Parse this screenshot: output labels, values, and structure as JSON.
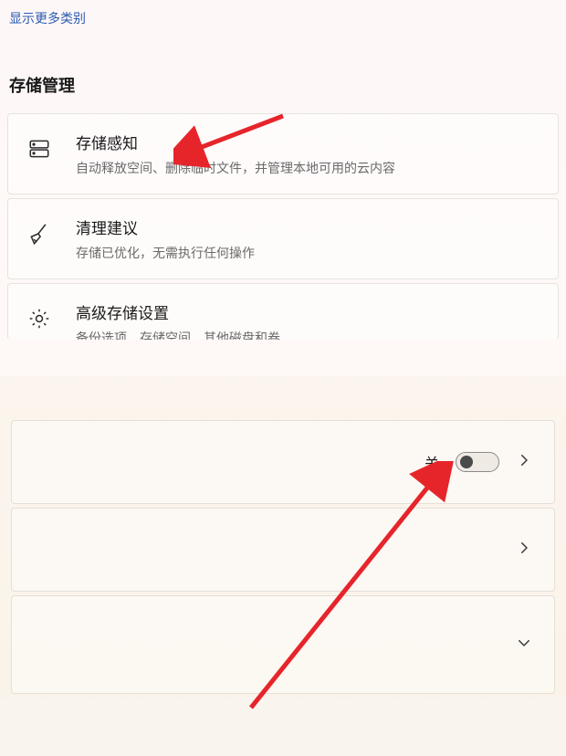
{
  "header": {
    "show_more_link": "显示更多类别",
    "section_heading": "存储管理"
  },
  "rows": {
    "storage_sense": {
      "title": "存储感知",
      "subtitle": "自动释放空间、删除临时文件，并管理本地可用的云内容"
    },
    "cleanup": {
      "title": "清理建议",
      "subtitle": "存储已优化，无需执行任何操作"
    },
    "advanced": {
      "title": "高级存储设置",
      "subtitle": "备份选项、存储空间、其他磁盘和卷"
    }
  },
  "panels": {
    "toggle_label": "关",
    "toggle_state": "off"
  }
}
